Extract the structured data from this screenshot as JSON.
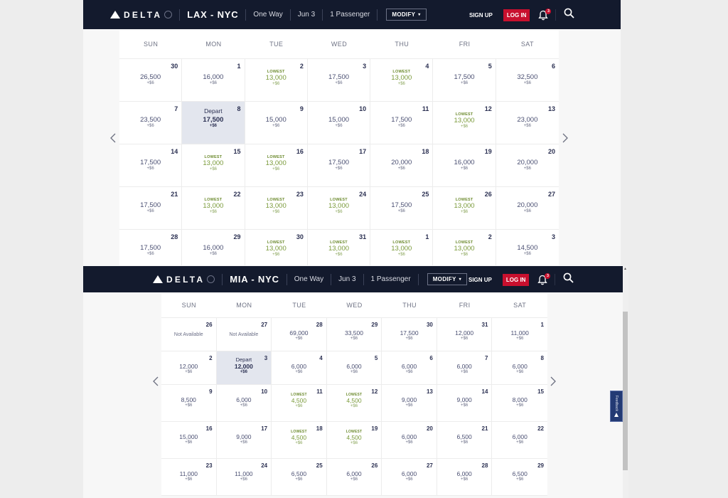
{
  "common": {
    "brand": "DELTA",
    "trip_type": "One Way",
    "date": "Jun 3",
    "passengers": "1 Passenger",
    "modify_label": "MODIFY",
    "signup_label": "SIGN UP",
    "login_label": "LOG IN",
    "notifications_count": "3",
    "weekdays": [
      "SUN",
      "MON",
      "TUE",
      "WED",
      "THU",
      "FRI",
      "SAT"
    ],
    "lowest_label": "LOWEST",
    "depart_label": "Depart",
    "not_available_label": "Not Available",
    "feedback_label": "Feedback",
    "colors": {
      "header_bg": "#131a2d",
      "login_red": "#c8102e",
      "lowest_green": "#7a9a3a",
      "selected_bg": "#e3e6ee"
    }
  },
  "calendars": [
    {
      "route": "LAX - NYC",
      "days": [
        {
          "day": "30",
          "price": "26,500",
          "fee": "+$6"
        },
        {
          "day": "1",
          "price": "16,000",
          "fee": "+$6"
        },
        {
          "day": "2",
          "price": "13,000",
          "fee": "+$6",
          "lowest": true
        },
        {
          "day": "3",
          "price": "17,500",
          "fee": "+$6"
        },
        {
          "day": "4",
          "price": "13,000",
          "fee": "+$6",
          "lowest": true
        },
        {
          "day": "5",
          "price": "17,500",
          "fee": "+$6"
        },
        {
          "day": "6",
          "price": "32,500",
          "fee": "+$6"
        },
        {
          "day": "7",
          "price": "23,500",
          "fee": "+$6"
        },
        {
          "day": "8",
          "price": "17,500",
          "fee": "+$6",
          "selected": true
        },
        {
          "day": "9",
          "price": "15,000",
          "fee": "+$6"
        },
        {
          "day": "10",
          "price": "15,000",
          "fee": "+$6"
        },
        {
          "day": "11",
          "price": "17,500",
          "fee": "+$6"
        },
        {
          "day": "12",
          "price": "13,000",
          "fee": "+$6",
          "lowest": true
        },
        {
          "day": "13",
          "price": "23,000",
          "fee": "+$6"
        },
        {
          "day": "14",
          "price": "17,500",
          "fee": "+$6"
        },
        {
          "day": "15",
          "price": "13,000",
          "fee": "+$6",
          "lowest": true
        },
        {
          "day": "16",
          "price": "13,000",
          "fee": "+$6",
          "lowest": true
        },
        {
          "day": "17",
          "price": "17,500",
          "fee": "+$6"
        },
        {
          "day": "18",
          "price": "20,000",
          "fee": "+$6"
        },
        {
          "day": "19",
          "price": "16,000",
          "fee": "+$6"
        },
        {
          "day": "20",
          "price": "20,000",
          "fee": "+$6"
        },
        {
          "day": "21",
          "price": "17,500",
          "fee": "+$6"
        },
        {
          "day": "22",
          "price": "13,000",
          "fee": "+$6",
          "lowest": true
        },
        {
          "day": "23",
          "price": "13,000",
          "fee": "+$6",
          "lowest": true
        },
        {
          "day": "24",
          "price": "13,000",
          "fee": "+$6",
          "lowest": true
        },
        {
          "day": "25",
          "price": "17,500",
          "fee": "+$6"
        },
        {
          "day": "26",
          "price": "13,000",
          "fee": "+$6",
          "lowest": true
        },
        {
          "day": "27",
          "price": "20,000",
          "fee": "+$6"
        },
        {
          "day": "28",
          "price": "17,500",
          "fee": "+$6"
        },
        {
          "day": "29",
          "price": "16,000",
          "fee": "+$6"
        },
        {
          "day": "30",
          "price": "13,000",
          "fee": "+$6",
          "lowest": true
        },
        {
          "day": "31",
          "price": "13,000",
          "fee": "+$6",
          "lowest": true
        },
        {
          "day": "1",
          "price": "13,000",
          "fee": "+$6",
          "lowest": true
        },
        {
          "day": "2",
          "price": "13,000",
          "fee": "+$6",
          "lowest": true
        },
        {
          "day": "3",
          "price": "14,500",
          "fee": "+$6"
        }
      ]
    },
    {
      "route": "MIA - NYC",
      "days": [
        {
          "day": "26",
          "not_available": true
        },
        {
          "day": "27",
          "not_available": true
        },
        {
          "day": "28",
          "price": "69,000",
          "fee": "+$6"
        },
        {
          "day": "29",
          "price": "33,500",
          "fee": "+$6"
        },
        {
          "day": "30",
          "price": "17,500",
          "fee": "+$6"
        },
        {
          "day": "31",
          "price": "12,000",
          "fee": "+$6"
        },
        {
          "day": "1",
          "price": "11,000",
          "fee": "+$6"
        },
        {
          "day": "2",
          "price": "12,000",
          "fee": "+$6"
        },
        {
          "day": "3",
          "price": "12,000",
          "fee": "+$6",
          "selected": true
        },
        {
          "day": "4",
          "price": "6,000",
          "fee": "+$6"
        },
        {
          "day": "5",
          "price": "6,000",
          "fee": "+$6"
        },
        {
          "day": "6",
          "price": "6,000",
          "fee": "+$6"
        },
        {
          "day": "7",
          "price": "6,000",
          "fee": "+$6"
        },
        {
          "day": "8",
          "price": "6,000",
          "fee": "+$6"
        },
        {
          "day": "9",
          "price": "8,500",
          "fee": "+$6"
        },
        {
          "day": "10",
          "price": "6,000",
          "fee": "+$6"
        },
        {
          "day": "11",
          "price": "4,500",
          "fee": "+$6",
          "lowest": true
        },
        {
          "day": "12",
          "price": "4,500",
          "fee": "+$6",
          "lowest": true
        },
        {
          "day": "13",
          "price": "9,000",
          "fee": "+$6"
        },
        {
          "day": "14",
          "price": "9,000",
          "fee": "+$6"
        },
        {
          "day": "15",
          "price": "8,000",
          "fee": "+$6"
        },
        {
          "day": "16",
          "price": "15,000",
          "fee": "+$6"
        },
        {
          "day": "17",
          "price": "9,000",
          "fee": "+$6"
        },
        {
          "day": "18",
          "price": "4,500",
          "fee": "+$6",
          "lowest": true
        },
        {
          "day": "19",
          "price": "4,500",
          "fee": "+$6",
          "lowest": true
        },
        {
          "day": "20",
          "price": "6,000",
          "fee": "+$6"
        },
        {
          "day": "21",
          "price": "6,500",
          "fee": "+$6"
        },
        {
          "day": "22",
          "price": "6,000",
          "fee": "+$6"
        },
        {
          "day": "23",
          "price": "11,000",
          "fee": "+$6"
        },
        {
          "day": "24",
          "price": "11,000",
          "fee": "+$6"
        },
        {
          "day": "25",
          "price": "6,500",
          "fee": "+$6"
        },
        {
          "day": "26",
          "price": "6,000",
          "fee": "+$6"
        },
        {
          "day": "27",
          "price": "6,000",
          "fee": "+$6"
        },
        {
          "day": "28",
          "price": "6,000",
          "fee": "+$6"
        },
        {
          "day": "29",
          "price": "6,500",
          "fee": "+$6"
        }
      ]
    }
  ]
}
